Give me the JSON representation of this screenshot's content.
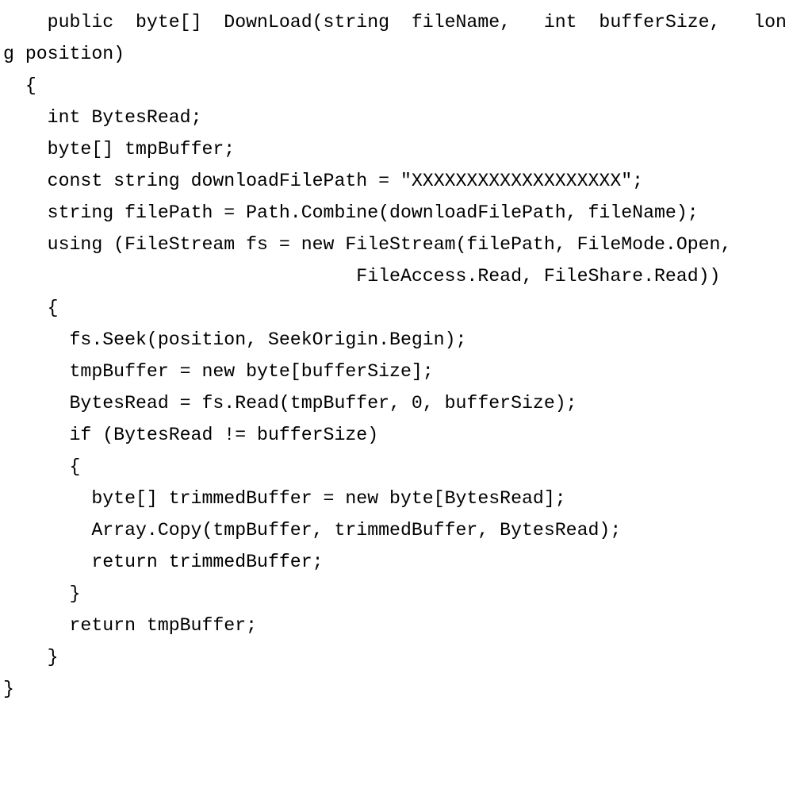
{
  "code": {
    "lines": [
      "    public  byte[]  DownLoad(string  fileName,   int  bufferSize,   long position)",
      "  {",
      "    int BytesRead;",
      "    byte[] tmpBuffer;",
      "    const string downloadFilePath = \"XXXXXXXXXXXXXXXXXXX\";",
      "    string filePath = Path.Combine(downloadFilePath, fileName);",
      "    using (FileStream fs = new FileStream(filePath, FileMode.Open,",
      "                                FileAccess.Read, FileShare.Read))",
      "    {",
      "      fs.Seek(position, SeekOrigin.Begin);",
      "      tmpBuffer = new byte[bufferSize];",
      "      BytesRead = fs.Read(tmpBuffer, 0, bufferSize);",
      "      if (BytesRead != bufferSize)",
      "      {",
      "        byte[] trimmedBuffer = new byte[BytesRead];",
      "        Array.Copy(tmpBuffer, trimmedBuffer, BytesRead);",
      "        return trimmedBuffer;",
      "      }",
      "      return tmpBuffer;",
      "    }",
      "}"
    ]
  }
}
